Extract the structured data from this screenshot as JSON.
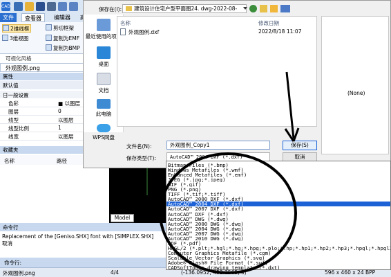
{
  "app": {
    "tabs": [
      "文件",
      "查看器",
      "编辑器",
      "高"
    ],
    "ribbon": {
      "btn_2d": "2维线框",
      "btn_3d": "3维视图",
      "btn_cut": "剪切框架",
      "btn_copy_emf": "复制为EMF",
      "btn_copy_bmp": "复制为BMP",
      "group_label": "可视化风格"
    },
    "file_tab": "外观图例.png",
    "props_header": "属性",
    "default_value": "默认值",
    "section": "日一般设置",
    "props": [
      {
        "key": "色彩",
        "value": "■ 以图层"
      },
      {
        "key": "图层",
        "value": "0"
      },
      {
        "key": "线型",
        "value": "以图层"
      },
      {
        "key": "线型比例",
        "value": "1"
      },
      {
        "key": "线宽",
        "value": "以图层"
      }
    ],
    "favorites_header": "收藏夹",
    "fav_col_name": "名称",
    "fav_col_path": "路径",
    "model_tab": "Model",
    "cmd_header": "命令行",
    "cmd_output": [
      "Replacement of the [Geniso.SHX] font with [SIMPLEX.SHX]",
      "取消"
    ],
    "cmd_input_label": "命令行:",
    "status": {
      "file": "外观图例.png",
      "page": "4/4",
      "coords": "(-136.0952; 452.3565; 0)",
      "image_info": "596 x 460 x 24 BPP"
    },
    "colors": {
      "accent": "#1c62d6",
      "toolbar": "#dbe6f4",
      "header": "#c7d8ef"
    }
  },
  "dialog": {
    "save_in_label": "保存在(I):",
    "save_in_value": "建筑设计住宅户型平面图24. dwg-2022-08-",
    "nav_items": [
      "最近使用的项目",
      "桌面",
      "文档",
      "此电脑",
      "WPS网盘"
    ],
    "col_name": "名称",
    "col_modified": "修改日期",
    "files": [
      {
        "name": "外观图例.dxf",
        "modified": "2022/8/18 11:07"
      }
    ],
    "preview_none": "(None)",
    "filename_label": "文件名(N):",
    "filename_value": "外观图例_Copy1",
    "filetype_label": "保存类型(T):",
    "filetype_value": "AutoCAD™ 2004 DXF (*.dxf)",
    "save_button": "保存(S)",
    "cancel_button": "取消",
    "icons": [
      "back-icon",
      "up-folder-icon",
      "new-folder-icon",
      "view-menu-icon"
    ]
  },
  "dropdown": {
    "items": [
      "Bitmap Files (*.bmp)",
      "Windows Metafiles (*.wmf)",
      "Enhanced Metafiles (*.emf)",
      "JPEG (*.jpg;*.jpeg)",
      "GIF (*.gif)",
      "PNG (*.png)",
      "TIFF (*.tif;*.tiff)",
      "AutoCAD™ 2000 DXF (*.dxf)",
      "AutoCAD™ 2004 DXF (*.dxf)",
      "AutoCAD™ 2007 DXF (*.dxf)",
      "AutoCAD™ DXF (*.dxf)",
      "AutoCAD™ DWG (*.dwg)",
      "AutoCAD™ 2000 DWG (*.dwg)",
      "AutoCAD™ 2004 DWG (*.dwg)",
      "AutoCAD™ 2007 DWG (*.dwg)",
      "AutoCAD™ 2010 DWG (*.dwg)",
      "PDF (*.pdf)",
      "HPGL/2 (*.plt;*.hgl;*.hg;*.hpg;*.plo;*.hp;*.hp1;*.hp2;*.hp3;*.hpgl;*.hpgl2;*.hpp;*.gl...",
      "Computer Graphics Metafile (*.cgm)",
      "Scalable Vector Graphics (*.svg)",
      "Adobe® Flash® File Format (*.swf)",
      "CADSoftTools drawing template (*.dxt)"
    ],
    "selected_index": 8
  }
}
